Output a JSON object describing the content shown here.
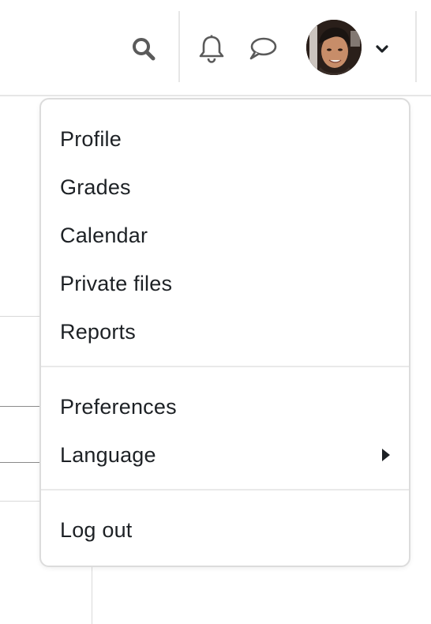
{
  "navbar": {
    "icons": [
      "search-icon",
      "bell-icon",
      "chat-bubble-icon",
      "chevron-down-icon"
    ],
    "avatar_alt": "User avatar"
  },
  "user_menu": {
    "items": [
      {
        "label": "Profile"
      },
      {
        "label": "Grades"
      },
      {
        "label": "Calendar"
      },
      {
        "label": "Private files"
      },
      {
        "label": "Reports"
      },
      {
        "label": "Preferences"
      },
      {
        "label": "Language",
        "has_submenu": true
      },
      {
        "label": "Log out"
      }
    ]
  },
  "colors": {
    "text": "#1d2125",
    "icon": "#5f5f5f",
    "border": "#dcdcdc"
  }
}
